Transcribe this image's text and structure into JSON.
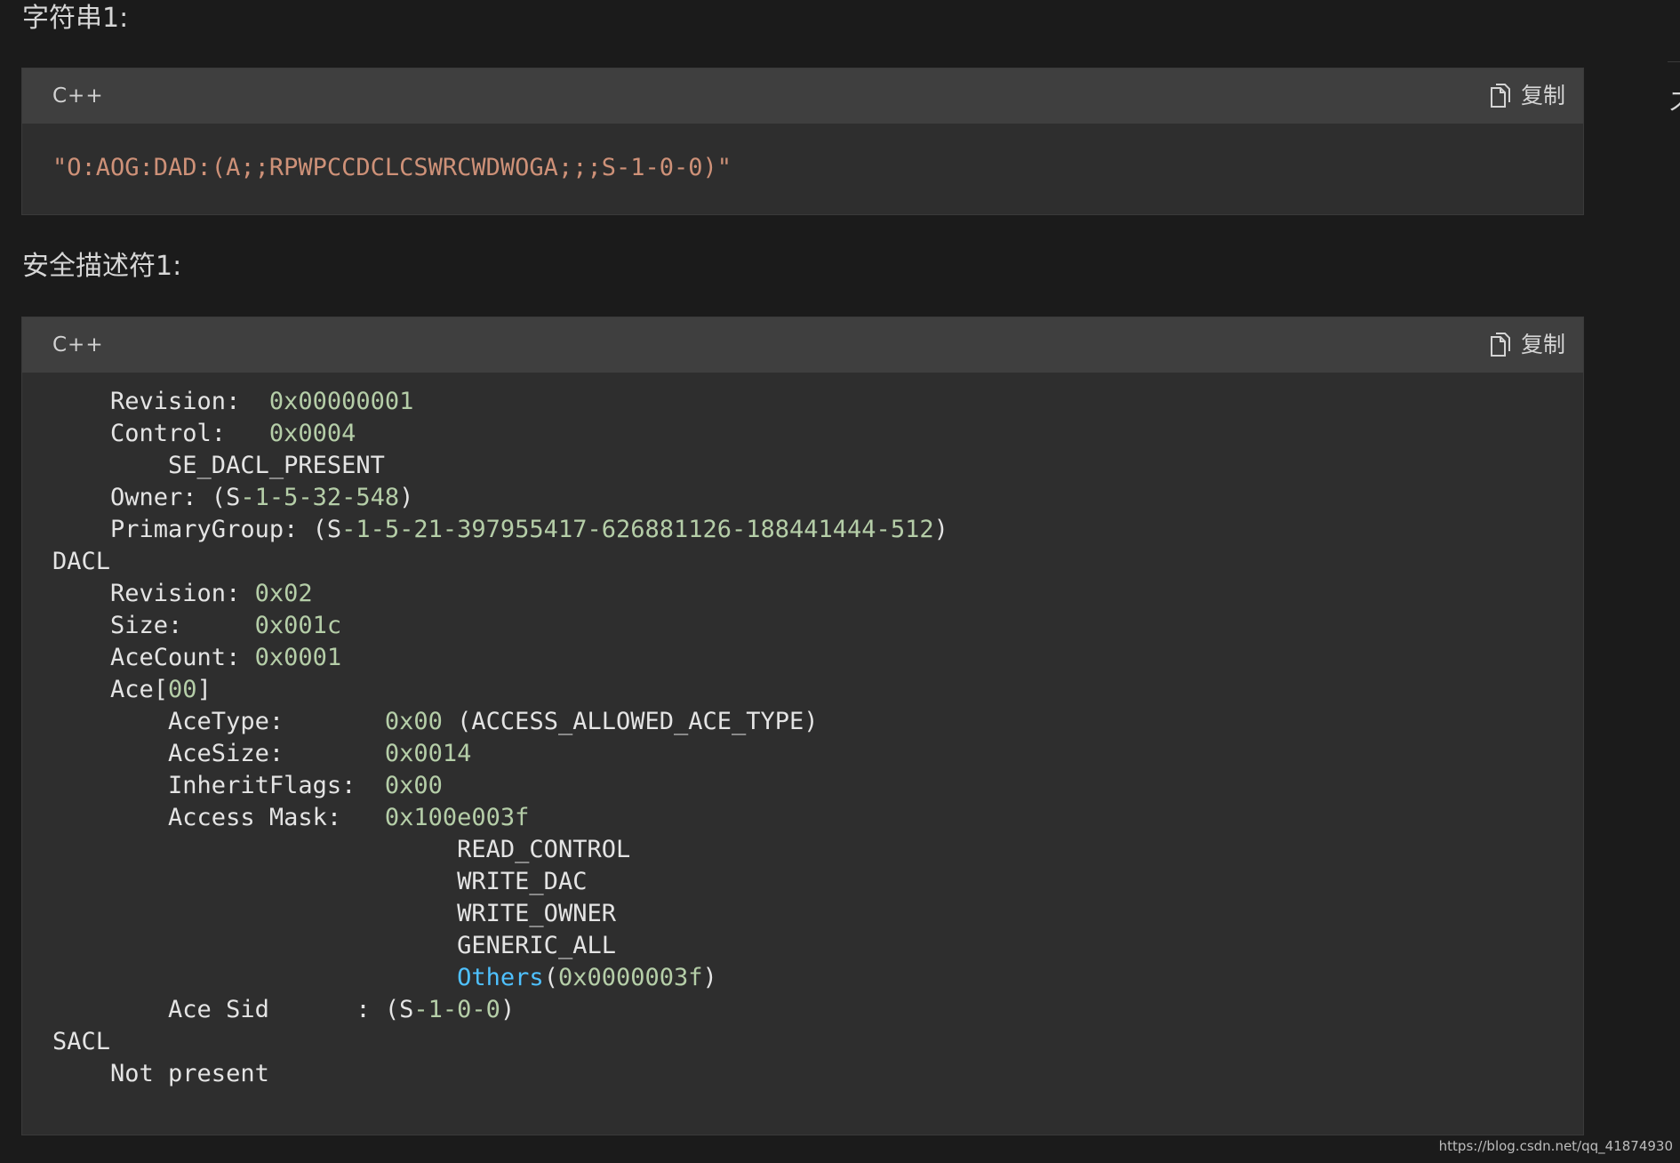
{
  "sections": [
    {
      "heading": "字符串1:",
      "code_block": {
        "language": "C++",
        "copy_label": "复制",
        "string_value": "\"O:AOG:DAD:(A;;RPWPCCDCLCSWRCWDWOGA;;;S-1-0-0)\""
      }
    },
    {
      "heading": "安全描述符1:",
      "code_block": {
        "language": "C++",
        "copy_label": "复制",
        "lines": {
          "revision_label": "    Revision:  ",
          "revision_value": "0x00000001",
          "control_label": "    Control:   ",
          "control_value": "0x0004",
          "control_flag": "        SE_DACL_PRESENT",
          "owner_prefix": "    Owner: (S",
          "owner_sid": "-1-5-32-548",
          "owner_suffix": ")",
          "group_prefix": "    PrimaryGroup: (S",
          "group_sid": "-1-5-21-397955417-626881126-188441444-512",
          "group_suffix": ")",
          "dacl_header": "DACL",
          "dacl_revision_label": "    Revision: ",
          "dacl_revision_value": "0x02",
          "dacl_size_label": "    Size:     ",
          "dacl_size_value": "0x001c",
          "dacl_acecount_label": "    AceCount: ",
          "dacl_acecount_value": "0x0001",
          "ace_prefix": "    Ace[",
          "ace_index": "00",
          "ace_suffix": "]",
          "acetype_label": "        AceType:       ",
          "acetype_value": "0x00",
          "acetype_desc": " (ACCESS_ALLOWED_ACE_TYPE)",
          "acesize_label": "        AceSize:       ",
          "acesize_value": "0x0014",
          "inheritflags_label": "        InheritFlags:  ",
          "inheritflags_value": "0x00",
          "accessmask_label": "        Access Mask:   ",
          "accessmask_value": "0x100e003f",
          "mask_flag_1": "                            READ_CONTROL",
          "mask_flag_2": "                            WRITE_DAC",
          "mask_flag_3": "                            WRITE_OWNER",
          "mask_flag_4": "                            GENERIC_ALL",
          "mask_others_indent": "                            ",
          "mask_others_keyword": "Others",
          "mask_others_open": "(",
          "mask_others_value": "0x0000003f",
          "mask_others_close": ")",
          "acesid_prefix": "        Ace Sid      : (S",
          "acesid_value": "-1-0-0",
          "acesid_suffix": ")",
          "sacl_header": "SACL",
          "sacl_status": "    Not present"
        }
      }
    }
  ],
  "right_edge_glyph": "ズ",
  "watermark": "https://blog.csdn.net/qq_41874930",
  "colors": {
    "background": "#1b1b1b",
    "code_background": "#2e2e2e",
    "code_header": "#3f3f3f",
    "string": "#ce9178",
    "number": "#b5cea8",
    "keyword": "#4fc1ff",
    "text": "#e4e4e4"
  },
  "icons": [
    "copy-icon"
  ]
}
